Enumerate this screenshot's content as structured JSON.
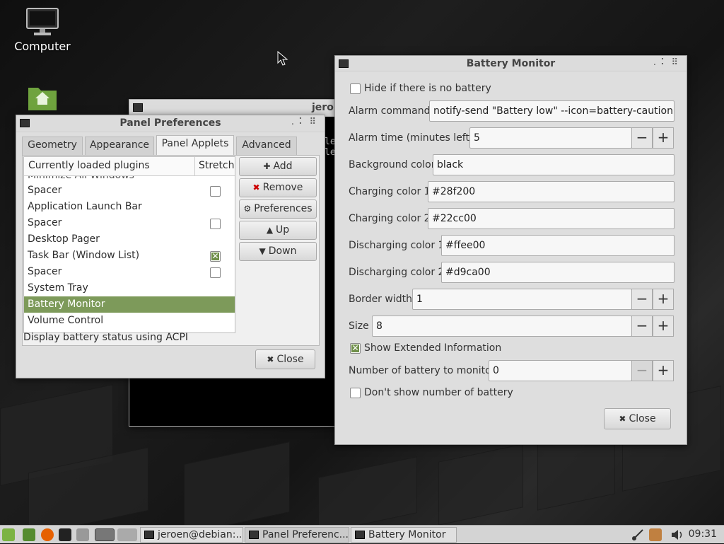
{
  "desktop": {
    "icons": [
      {
        "label": "Computer",
        "icon": "monitor-icon"
      },
      {
        "label": "",
        "icon": "home-folder-icon"
      }
    ]
  },
  "terminal": {
    "title": "jero",
    "lines": [
      "le",
      "le"
    ]
  },
  "panel_prefs": {
    "title": "Panel Preferences",
    "tabs": [
      "Geometry",
      "Appearance",
      "Panel Applets",
      "Advanced"
    ],
    "active_tab": "Panel Applets",
    "list_headers": [
      "Currently loaded plugins",
      "Stretch"
    ],
    "partial_top": "Minimize All Windows",
    "plugins": [
      {
        "name": "Spacer",
        "stretch": "off"
      },
      {
        "name": "Application Launch Bar",
        "stretch": "none"
      },
      {
        "name": "Spacer",
        "stretch": "off"
      },
      {
        "name": "Desktop Pager",
        "stretch": "none"
      },
      {
        "name": "Task Bar (Window List)",
        "stretch": "on"
      },
      {
        "name": "Spacer",
        "stretch": "off"
      },
      {
        "name": "System Tray",
        "stretch": "none"
      },
      {
        "name": "Battery Monitor",
        "stretch": "none",
        "selected": true
      },
      {
        "name": "Volume Control",
        "stretch": "none"
      }
    ],
    "buttons": {
      "add": "Add",
      "remove": "Remove",
      "preferences": "Preferences",
      "up": "Up",
      "down": "Down",
      "close": "Close"
    },
    "status": "Display battery status using ACPI"
  },
  "battery_monitor": {
    "title": "Battery Monitor",
    "hide_no_battery": "Hide if there is no battery",
    "alarm_command_label": "Alarm command",
    "alarm_command": "notify-send \"Battery low\" --icon=battery-caution",
    "alarm_time_label": "Alarm time (minutes left)",
    "alarm_time": "5",
    "bg_color_label": "Background color",
    "bg_color": "black",
    "charging1_label": "Charging color 1",
    "charging1": "#28f200",
    "charging2_label": "Charging color 2",
    "charging2": "#22cc00",
    "discharging1_label": "Discharging color 1",
    "discharging1": "#ffee00",
    "discharging2_label": "Discharging color 2",
    "discharging2": "#d9ca00",
    "border_width_label": "Border width",
    "border_width": "1",
    "size_label": "Size",
    "size": "8",
    "show_extended": "Show Extended Information",
    "battery_num_label": "Number of battery to monitor",
    "battery_num": "0",
    "dont_show_num": "Don't show number of battery",
    "close": "Close",
    "spin_minus": "−",
    "spin_plus": "+"
  },
  "taskbar": {
    "tasks": [
      "jeroen@debian:...",
      "Panel Preferenc...",
      "Battery Monitor"
    ],
    "clock": "09:31"
  },
  "colors": {
    "selection": "#7d9a5a",
    "accent_green": "#6f8f49"
  }
}
